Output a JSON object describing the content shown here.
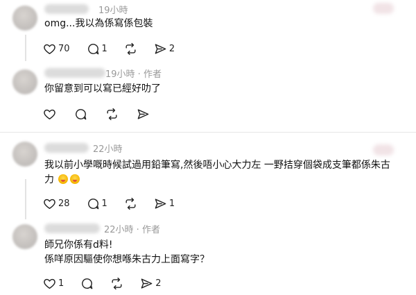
{
  "comments": [
    {
      "time": "19小時",
      "author_tag": "",
      "lines": [
        "omg...我以為係寫係包裝"
      ],
      "likes": "70",
      "replies": "1",
      "reposts": "",
      "shares": "2"
    },
    {
      "time": "19小時",
      "author_tag": "作者",
      "lines": [
        "你留意到可以寫已經好叻了"
      ],
      "likes": "",
      "replies": "",
      "reposts": "",
      "shares": ""
    },
    {
      "time": "22小時",
      "author_tag": "",
      "lines": [
        "我以前小學嘅時候試過用鉛筆寫,然後唔小心大力左 一野拮穿個袋成支筆都係朱古",
        "力"
      ],
      "likes": "28",
      "replies": "1",
      "reposts": "",
      "shares": "1"
    },
    {
      "time": "22小時",
      "author_tag": "作者",
      "lines": [
        "師兄你係有d料!",
        "係咩原因驅使你想喺朱古力上面寫字？"
      ],
      "likes": "1",
      "replies": "",
      "reposts": "",
      "shares": "2"
    }
  ],
  "separator": " · ",
  "icons": [
    "heart-icon",
    "comment-icon",
    "repost-icon",
    "share-icon",
    "more-icon",
    "emoji-icon"
  ]
}
